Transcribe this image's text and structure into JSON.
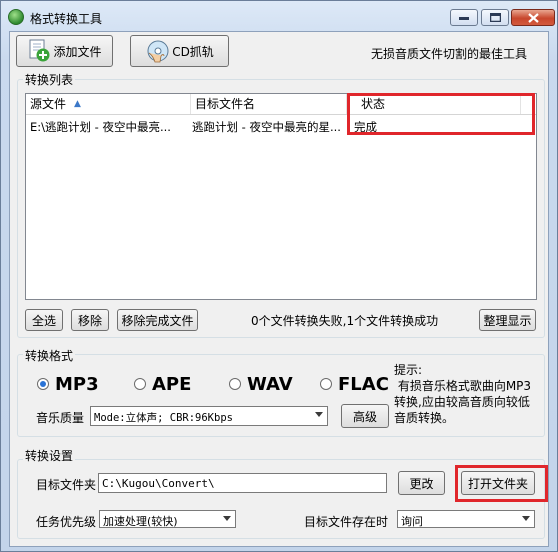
{
  "window": {
    "title": "格式转换工具"
  },
  "toolbar": {
    "add_file_label": "添加文件",
    "cd_rip_label": "CD抓轨",
    "slogan": "无损音质文件切割的最佳工具"
  },
  "convert_list": {
    "group_label": "转换列表",
    "columns": [
      "源文件",
      "目标文件名",
      "状态"
    ],
    "rows": [
      {
        "source": "E:\\逃跑计划 - 夜空中最亮...",
        "target": "逃跑计划 - 夜空中最亮的星...",
        "status": "完成"
      }
    ]
  },
  "list_actions": {
    "select_all_label": "全选",
    "remove_label": "移除",
    "remove_done_label": "移除完成文件",
    "status_text": "0个文件转换失败,1个文件转换成功",
    "tidy_label": "整理显示"
  },
  "format": {
    "group_label": "转换格式",
    "options": [
      "MP3",
      "APE",
      "WAV",
      "FLAC"
    ],
    "selected": "MP3",
    "hint": "提示:\n 有损音乐格式歌曲向MP3转换,应由较高音质向较低音质转换。",
    "quality_label": "音乐质量",
    "quality_value": "Mode:立体声; CBR:96Kbps",
    "advanced_label": "高级"
  },
  "settings": {
    "group_label": "转换设置",
    "target_folder_label": "目标文件夹",
    "target_folder_value": "C:\\Kugou\\Convert\\",
    "change_label": "更改",
    "open_folder_label": "打开文件夹",
    "priority_label": "任务优先级",
    "priority_value": "加速处理(较快)",
    "exists_label": "目标文件存在时",
    "exists_value": "询问"
  },
  "colors": {
    "highlight": "#e0262b",
    "radio_on": "#2a73d6"
  }
}
